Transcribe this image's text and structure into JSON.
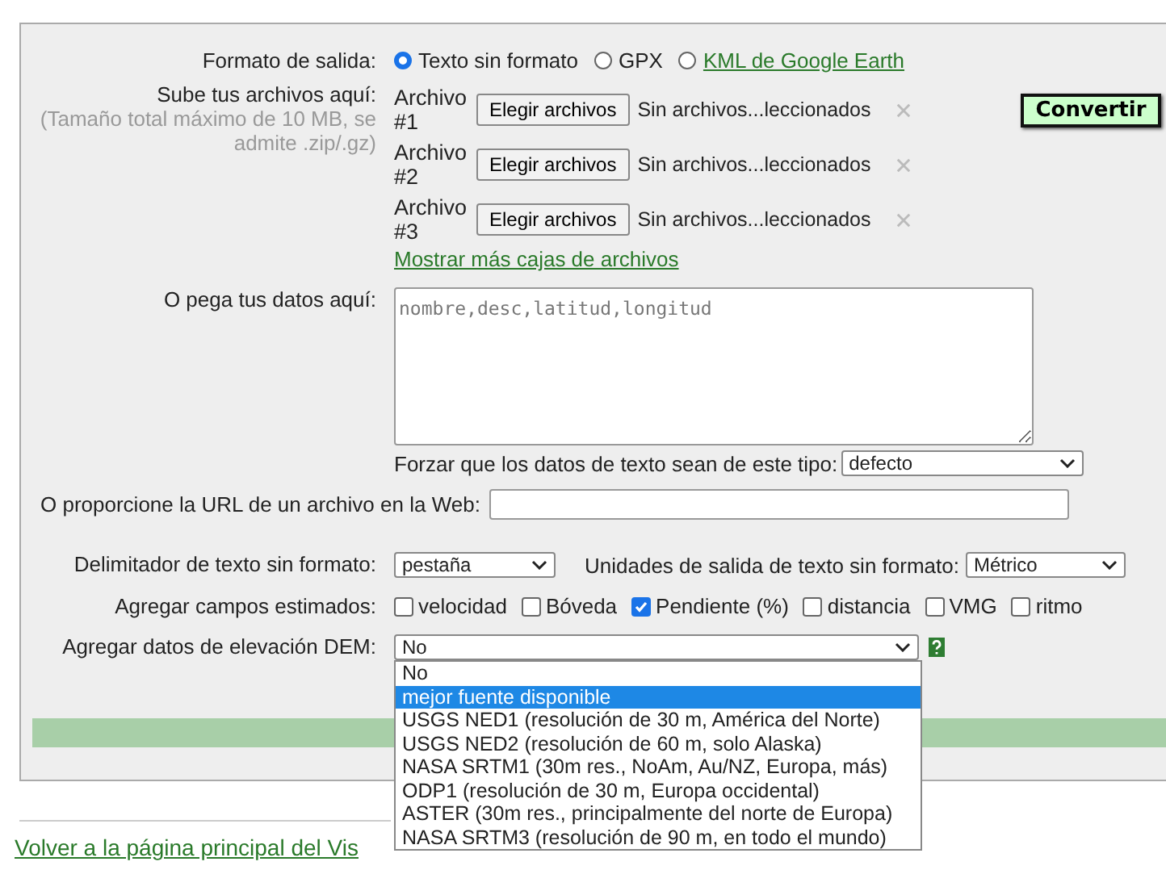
{
  "output_format": {
    "label": "Formato de salida:",
    "options": [
      {
        "label": "Texto sin formato",
        "selected": true,
        "kind": "text"
      },
      {
        "label": "GPX",
        "selected": false,
        "kind": "text"
      },
      {
        "label": "KML de Google Earth",
        "selected": false,
        "kind": "link"
      }
    ]
  },
  "upload": {
    "label": "Sube tus archivos aquí:",
    "note": "(Tamaño total máximo de 10 MB, se admite .zip/.gz)",
    "files": [
      {
        "label": "Archivo #1",
        "button": "Elegir archivos",
        "status": "Sin archivos...leccionados"
      },
      {
        "label": "Archivo #2",
        "button": "Elegir archivos",
        "status": "Sin archivos...leccionados"
      },
      {
        "label": "Archivo #3",
        "button": "Elegir archivos",
        "status": "Sin archivos...leccionados"
      }
    ],
    "more_link": "Mostrar más cajas de archivos"
  },
  "convert_button": "Convertir",
  "paste": {
    "label": "O pega tus datos aquí:",
    "placeholder": "nombre,desc,latitud,longitud",
    "force_label": "Forzar que los datos de texto sean de este tipo:",
    "force_value": "defecto"
  },
  "url": {
    "label": "O proporcione la URL de un archivo en la Web:"
  },
  "delimiter": {
    "label": "Delimitador de texto sin formato:",
    "value": "pestaña"
  },
  "units": {
    "label": "Unidades de salida de texto sin formato:",
    "value": "Métrico"
  },
  "estimated": {
    "label": "Agregar campos estimados:",
    "fields": [
      {
        "label": "velocidad",
        "checked": false
      },
      {
        "label": "Bóveda",
        "checked": false
      },
      {
        "label": "Pendiente (%)",
        "checked": true
      },
      {
        "label": "distancia",
        "checked": false
      },
      {
        "label": "VMG",
        "checked": false
      },
      {
        "label": "ritmo",
        "checked": false
      }
    ]
  },
  "dem": {
    "label": "Agregar datos de elevación DEM:",
    "value": "No",
    "options": [
      {
        "label": "No",
        "highlighted": false
      },
      {
        "label": "mejor fuente disponible",
        "highlighted": true
      },
      {
        "label": "USGS NED1 (resolución de 30 m, América del Norte)",
        "highlighted": false
      },
      {
        "label": "USGS NED2 (resolución de 60 m, solo Alaska)",
        "highlighted": false
      },
      {
        "label": "NASA SRTM1 (30m res., NoAm, Au/NZ, Europa, más)",
        "highlighted": false
      },
      {
        "label": "ODP1 (resolución de 30 m, Europa occidental)",
        "highlighted": false
      },
      {
        "label": "ASTER (30m res., principalmente del norte de Europa)",
        "highlighted": false
      },
      {
        "label": "NASA SRTM3 (resolución de 90 m, en todo el mundo)",
        "highlighted": false
      }
    ]
  },
  "back_link": "Volver a la página principal del Vis"
}
